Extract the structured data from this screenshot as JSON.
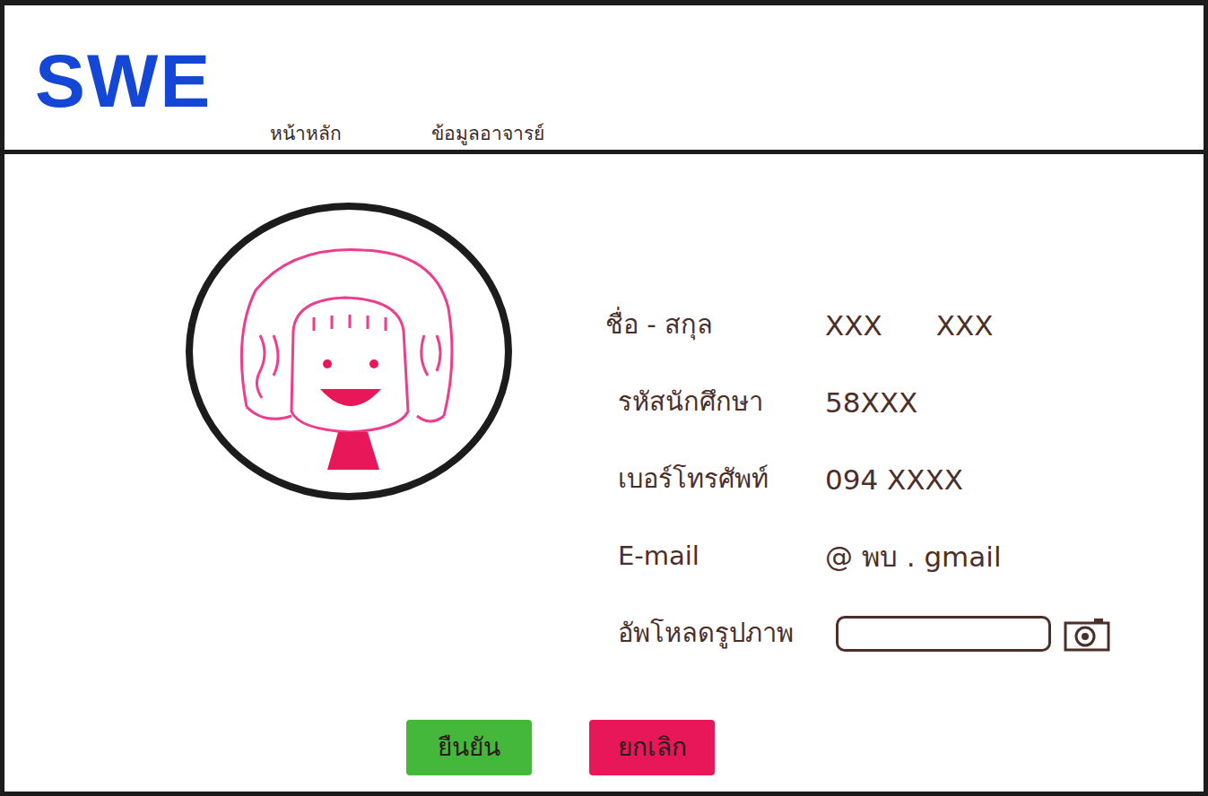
{
  "logo": "SWE",
  "nav": [
    {
      "label": "หน้าหลัก"
    },
    {
      "label": "ข้อมูลอาจารย์"
    }
  ],
  "profile": {
    "fields": [
      {
        "label": "ชื่อ - สกุล",
        "values": [
          "XXX",
          "XXX"
        ]
      },
      {
        "label": "รหัสนักศึกษา",
        "values": [
          "58XXX"
        ]
      },
      {
        "label": "เบอร์โทรศัพท์",
        "values": [
          "094 XXXX"
        ]
      },
      {
        "label": "E-mail",
        "values": [
          "@ พบ . gmail"
        ]
      }
    ],
    "upload": {
      "label": "อัพโหลดรูปภาพ"
    }
  },
  "buttons": [
    {
      "label": "ยืนยัน",
      "color": "#44b83a"
    },
    {
      "label": "ยกเลิก",
      "color": "#e8175a"
    }
  ]
}
